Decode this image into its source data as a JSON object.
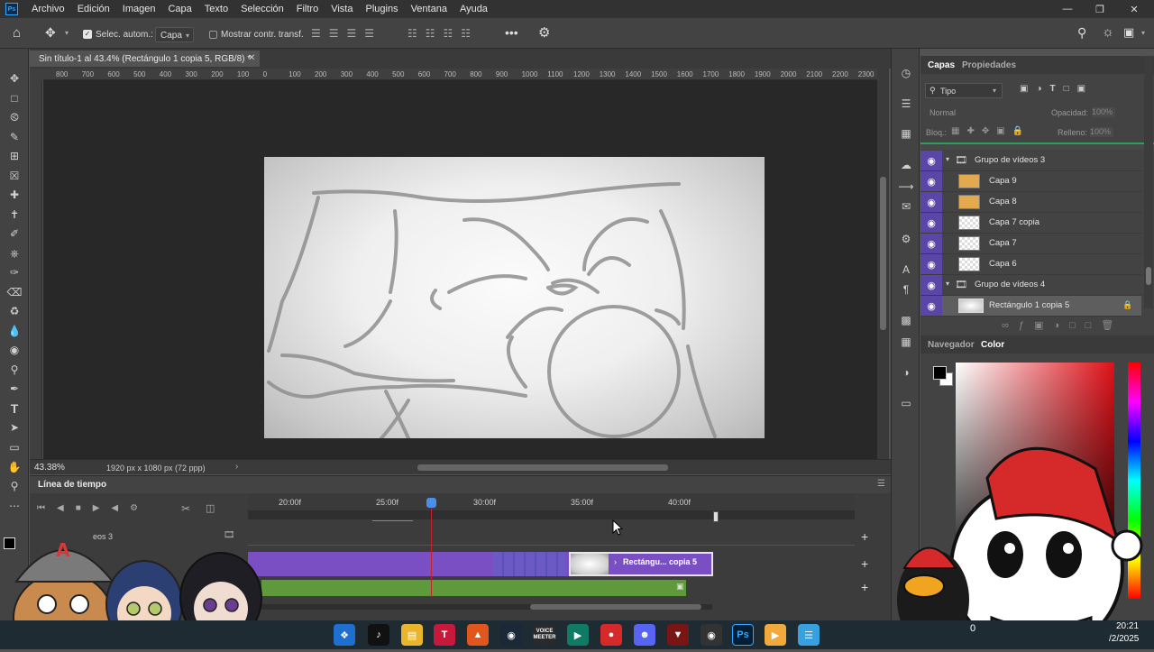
{
  "menubar": {
    "app_icon": "photoshop-logo",
    "items": [
      "Archivo",
      "Edición",
      "Imagen",
      "Capa",
      "Texto",
      "Selección",
      "Filtro",
      "Vista",
      "Plugins",
      "Ventana",
      "Ayuda"
    ]
  },
  "options_bar": {
    "auto_select_label": "Selec. autom.:",
    "auto_select_checked": true,
    "auto_select_value": "Capa",
    "show_transform_label": "Mostrar contr. transf.",
    "show_transform_checked": false
  },
  "document": {
    "tab_title": "Sin título-1 al 43.4% (Rectángulo 1 copia 5, RGB/8) *",
    "zoom": "43.38%",
    "info": "1920 px x 1080 px (72 ppp)"
  },
  "ruler_labels": [
    "800",
    "700",
    "600",
    "500",
    "400",
    "300",
    "200",
    "100",
    "0",
    "100",
    "200",
    "300",
    "400",
    "500",
    "600",
    "700",
    "800",
    "900",
    "1000",
    "1100",
    "1200",
    "1300",
    "1400",
    "1500",
    "1600",
    "1700",
    "1800",
    "1900",
    "2000",
    "2100",
    "2200",
    "2300"
  ],
  "timeline": {
    "title": "Línea de tiempo",
    "time_labels": [
      "20:00f",
      "25:00f",
      "30:00f",
      "35:00f",
      "40:00f"
    ],
    "group_label": "eos 3",
    "clip_label": "Rectángu... copia 5"
  },
  "layers_panel": {
    "tabs": [
      "Capas",
      "Propiedades"
    ],
    "filter_label": "Tipo",
    "blend_mode": "Normal",
    "opacity_label": "Opacidad:",
    "opacity_value": "100%",
    "lock_label": "Bloq.:",
    "fill_label": "Relleno:",
    "fill_value": "100%",
    "layers": [
      {
        "name": "Grupo de vídeos 3",
        "type": "group"
      },
      {
        "name": "Capa 9",
        "type": "layer"
      },
      {
        "name": "Capa 8",
        "type": "layer"
      },
      {
        "name": "Capa 7 copia",
        "type": "layer"
      },
      {
        "name": "Capa 7",
        "type": "layer"
      },
      {
        "name": "Capa 6",
        "type": "layer"
      },
      {
        "name": "Grupo de vídeos 4",
        "type": "group"
      },
      {
        "name": "Rectángulo 1 copia 5",
        "type": "layer",
        "selected": true,
        "locked": true
      }
    ]
  },
  "color_panel": {
    "tabs": [
      "Navegador",
      "Color"
    ]
  },
  "taskbar": {
    "time": "20:21",
    "date": "/2/2025",
    "partial_text": "0",
    "app_badge": "VOICE MEETER"
  },
  "colors": {
    "accent_purple": "#7b4fc4",
    "track_green": "#5e9a3c",
    "playhead": "#c8202a",
    "eye_column": "#5a46a6"
  }
}
